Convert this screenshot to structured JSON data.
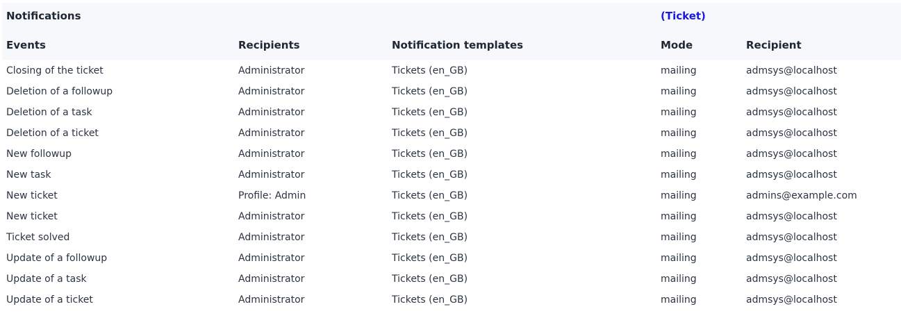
{
  "header": {
    "title": "Notifications",
    "itemtype_link": "(Ticket)"
  },
  "columns": {
    "events": "Events",
    "recipients": "Recipients",
    "templates": "Notification templates",
    "mode": "Mode",
    "recipient": "Recipient"
  },
  "rows": [
    {
      "event": "Closing of the ticket",
      "recipients": "Administrator",
      "template": "Tickets (en_GB)",
      "mode": "mailing",
      "recipient": "admsys@localhost"
    },
    {
      "event": "Deletion of a followup",
      "recipients": "Administrator",
      "template": "Tickets (en_GB)",
      "mode": "mailing",
      "recipient": "admsys@localhost"
    },
    {
      "event": "Deletion of a task",
      "recipients": "Administrator",
      "template": "Tickets (en_GB)",
      "mode": "mailing",
      "recipient": "admsys@localhost"
    },
    {
      "event": "Deletion of a ticket",
      "recipients": "Administrator",
      "template": "Tickets (en_GB)",
      "mode": "mailing",
      "recipient": "admsys@localhost"
    },
    {
      "event": "New followup",
      "recipients": "Administrator",
      "template": "Tickets (en_GB)",
      "mode": "mailing",
      "recipient": "admsys@localhost"
    },
    {
      "event": "New task",
      "recipients": "Administrator",
      "template": "Tickets (en_GB)",
      "mode": "mailing",
      "recipient": "admsys@localhost"
    },
    {
      "event": "New ticket",
      "recipients": "Profile: Admin",
      "template": "Tickets (en_GB)",
      "mode": "mailing",
      "recipient": "admins@example.com"
    },
    {
      "event": "New ticket",
      "recipients": "Administrator",
      "template": "Tickets (en_GB)",
      "mode": "mailing",
      "recipient": "admsys@localhost"
    },
    {
      "event": "Ticket solved",
      "recipients": "Administrator",
      "template": "Tickets (en_GB)",
      "mode": "mailing",
      "recipient": "admsys@localhost"
    },
    {
      "event": "Update of a followup",
      "recipients": "Administrator",
      "template": "Tickets (en_GB)",
      "mode": "mailing",
      "recipient": "admsys@localhost"
    },
    {
      "event": "Update of a task",
      "recipients": "Administrator",
      "template": "Tickets (en_GB)",
      "mode": "mailing",
      "recipient": "admsys@localhost"
    },
    {
      "event": "Update of a ticket",
      "recipients": "Administrator",
      "template": "Tickets (en_GB)",
      "mode": "mailing",
      "recipient": "admsys@localhost"
    }
  ],
  "colors": {
    "header_background": "#f6f8fb",
    "link": "#1a1adb",
    "text": "#1f2733"
  }
}
